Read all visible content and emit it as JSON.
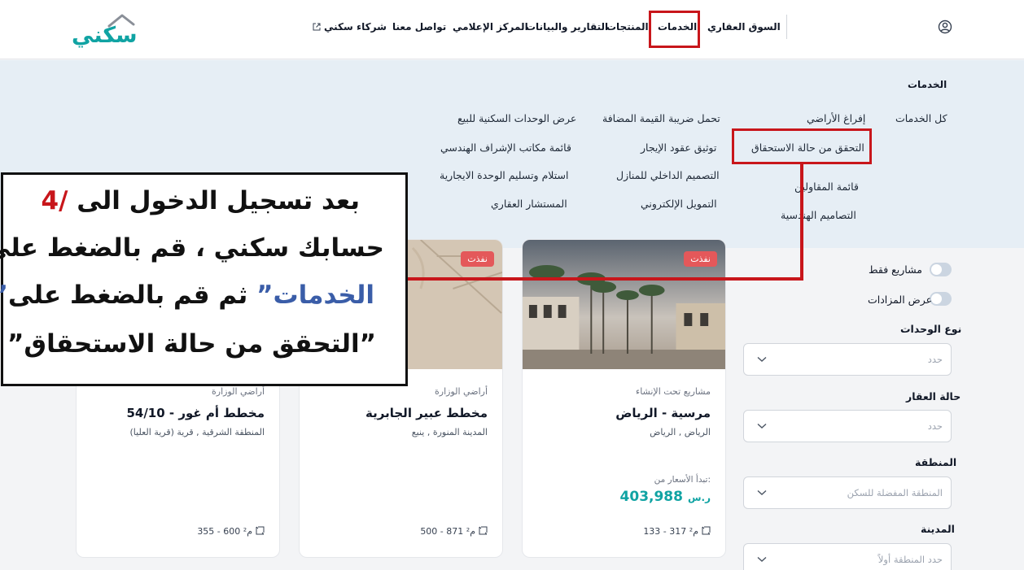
{
  "header": {
    "logo_text": "سكني",
    "nav": {
      "market": "السوق العقاري",
      "services": "الخدمات",
      "products": "المنتجات",
      "reports": "التقارير والبيانات",
      "media": "المركز الإعلامي",
      "contact": "تواصل معنا",
      "partners": "شركاء سكني"
    },
    "icons": {
      "user": "user-circle-icon",
      "external": "external-link-icon"
    }
  },
  "menu": {
    "title": "الخدمات",
    "col1": [
      "كل الخدمات"
    ],
    "col2": [
      "إفراغ الأراضي",
      "التحقق من حالة الاستحقاق",
      "قائمة المقاولين",
      "التصاميم الهندسية"
    ],
    "col3": [
      "تحمل ضريبة القيمة المضافة",
      "توثيق عقود الإيجار",
      "التصميم الداخلي للمنازل",
      "التمويل الإلكتروني"
    ],
    "col4": [
      "عرض الوحدات السكنية للبيع",
      "قائمة مكاتب الإشراف الهندسي",
      "استلام وتسليم الوحدة الايجارية",
      "المستشار العقاري"
    ]
  },
  "filters": {
    "toggle_projects": "مشاريع فقط",
    "toggle_auctions": "عرض المزادات",
    "unit_type_label": "نوع الوحدات",
    "unit_type_placeholder": "حدد",
    "property_status_label": "حالة العقار",
    "property_status_placeholder": "حدد",
    "region_label": "المنطقة",
    "region_placeholder": "المنطقة المفضلة للسكن",
    "city_label": "المدينة",
    "city_placeholder": "حدد المنطقة أولاً"
  },
  "cards": [
    {
      "badge": "نفذت",
      "category": "مشاريع تحت الإنشاء",
      "title": "مرسية - الرياض",
      "location": "الرياض , الرياض",
      "price_from": "تبدأ الأسعار من:",
      "price": "403,988",
      "currency": "ر.س",
      "area": "133 - 317 م²"
    },
    {
      "badge": "نفذت",
      "category": "أراضي الوزارة",
      "title": "مخطط عبير الجابرية",
      "location": "المدينة المنورة , ينبع",
      "area": "500 - 871 م²"
    },
    {
      "category": "أراضي الوزارة",
      "title": "مخطط أم غور - 54/10",
      "location": "المنطقة الشرقية , قرية (قرية العليا)",
      "area": "355 - 600 م²"
    }
  ],
  "annotation": {
    "step": "4/",
    "line1": "بعد تسجيل الدخول الى",
    "line2": "حسابك سكني ، قم بالضغط على",
    "line3_quote": "”الخدمات”",
    "line3_rest": "ثم قم بالضغط على",
    "line4": "”التحقق من حالة الاستحقاق”"
  },
  "colors": {
    "brand": "#10a3a3",
    "highlight": "#c8161b",
    "badge": "#e4585a",
    "annotation_blue": "#3a5da8"
  }
}
